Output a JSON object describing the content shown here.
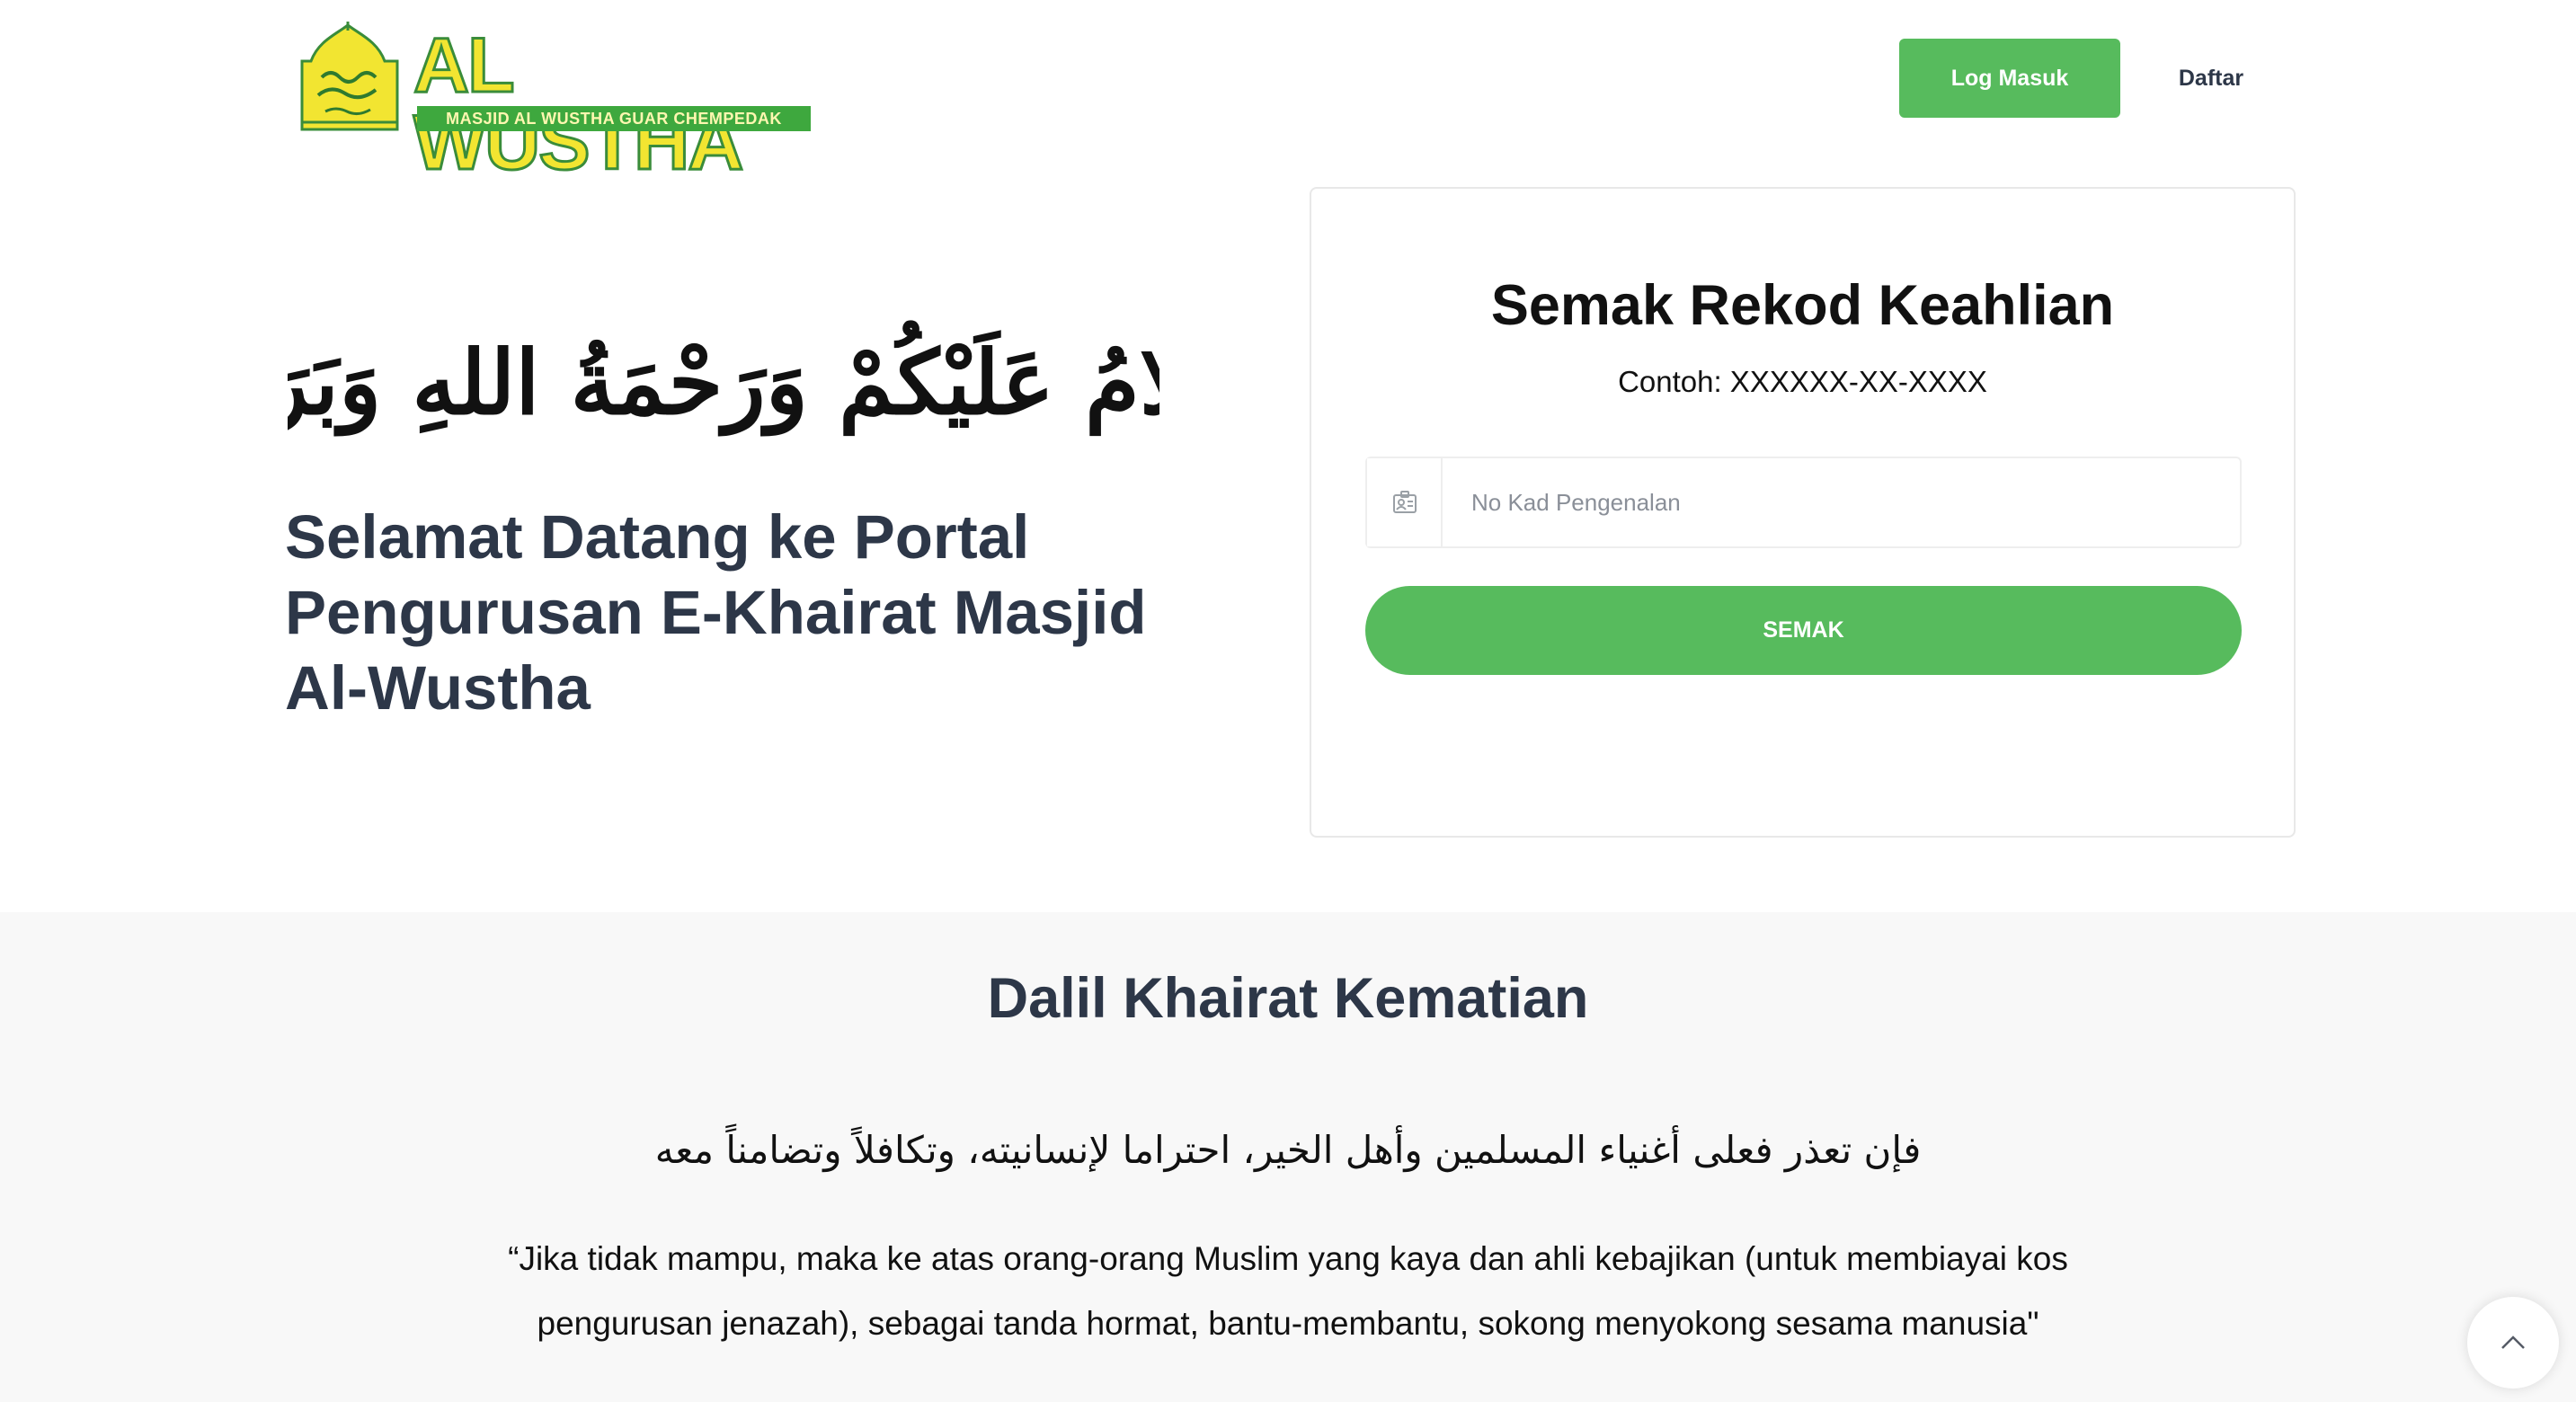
{
  "brand": {
    "title": "AL WUSTHA",
    "subtitle": "MASJID AL WUSTHA GUAR CHEMPEDAK",
    "colors": {
      "primary_green": "#57bb5d",
      "logo_yellow": "#f2e531",
      "logo_green": "#3ea83e"
    }
  },
  "nav": {
    "login_label": "Log Masuk",
    "register_label": "Daftar"
  },
  "hero": {
    "greeting_arabic": "السَّلَامُ عَلَيْكُمْ وَرَحْمَةُ اللهِ وَبَرَكَاتُهُ",
    "title": "Selamat Datang ke Portal Pengurusan E-Khairat Masjid Al-Wustha"
  },
  "check_card": {
    "title": "Semak Rekod Keahlian",
    "example": "Contoh: XXXXXX-XX-XXXX",
    "input_placeholder": "No Kad Pengenalan",
    "input_value": "",
    "input_icon": "id-card-icon",
    "button_label": "SEMAK"
  },
  "dalil": {
    "title": "Dalil Khairat Kematian",
    "arabic": "فإن تعذر فعلى أغنياء المسلمين وأهل الخير، احتراما لإنسانيته، وتكافلاً وتضامناً معه",
    "translation": "“Jika tidak mampu, maka ke atas orang-orang Muslim yang kaya dan ahli kebajikan (untuk membiayai kos pengurusan jenazah), sebagai tanda hormat, bantu-membantu, sokong menyokong sesama manusia\""
  },
  "scroll_top": {
    "icon": "chevron-up-icon"
  }
}
